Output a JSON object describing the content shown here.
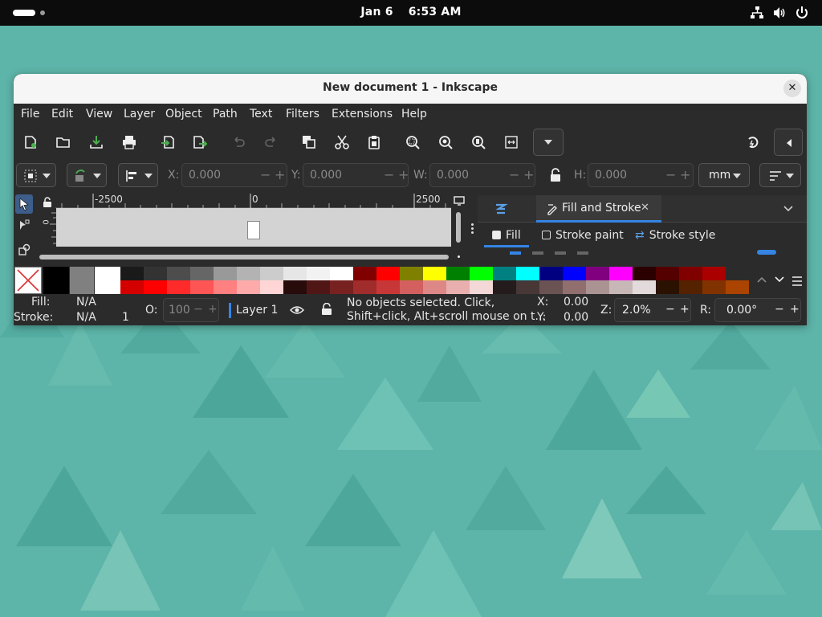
{
  "topbar": {
    "date": "Jan 6",
    "time": "6:53 AM",
    "tray_icons": [
      "network-icon",
      "volume-icon",
      "power-icon"
    ]
  },
  "window": {
    "title": "New document 1 - Inkscape",
    "close_label": "✕"
  },
  "menu": [
    "File",
    "Edit",
    "View",
    "Layer",
    "Object",
    "Path",
    "Text",
    "Filters",
    "Extensions",
    "Help"
  ],
  "toolbar": {
    "icons": [
      "new-document-icon",
      "open-icon",
      "save-icon",
      "print-icon",
      "import-icon",
      "export-icon",
      "undo-icon",
      "redo-icon",
      "duplicate-icon",
      "cut-icon",
      "paste-icon",
      "zoom-selection-icon",
      "zoom-drawing-icon",
      "zoom-page-icon",
      "zoom-width-icon",
      "more-dropdown-icon",
      "snap-icon",
      "collapse-icon"
    ]
  },
  "coords": {
    "x_label": "X:",
    "x_value": "0.000",
    "y_label": "Y:",
    "y_value": "0.000",
    "w_label": "W:",
    "w_value": "0.000",
    "h_label": "H:",
    "h_value": "0.000",
    "unit": "mm"
  },
  "ruler": {
    "h_ticks": [
      "-2500",
      "0",
      "2500"
    ],
    "v_tick": "0"
  },
  "dock": {
    "tab_label": "Fill and Stroke",
    "tab_close": "✕",
    "subtabs": [
      "Fill",
      "Stroke paint",
      "Stroke style"
    ]
  },
  "palette": {
    "row1": [
      "#000000",
      "#808080",
      "#ffffff",
      "#1a1a1a",
      "#333333",
      "#4d4d4d",
      "#666666",
      "#999999",
      "#b3b3b3",
      "#cccccc",
      "#e6e6e6",
      "#f2f2f2",
      "#ffffff",
      "#800000",
      "#ff0000",
      "#808000",
      "#ffff00",
      "#008000",
      "#00ff00",
      "#008080",
      "#00ffff",
      "#000080",
      "#0000ff",
      "#800080",
      "#ff00ff",
      "#2b0000",
      "#550000",
      "#800000",
      "#aa0000"
    ],
    "row2": [
      "#000000",
      "#808080",
      "#ffffff",
      "#d40000",
      "#ff0000",
      "#ff2a2a",
      "#ff5555",
      "#ff8080",
      "#ffaaaa",
      "#ffd5d5",
      "#280b0b",
      "#501616",
      "#782121",
      "#a02c2c",
      "#c83737",
      "#d35f5f",
      "#de8787",
      "#e9afaf",
      "#f4d7d7",
      "#241c1c",
      "#483737",
      "#6c5353",
      "#916f6f",
      "#ac9393",
      "#c8b7b7",
      "#e3dbdb",
      "#2b1100",
      "#552200",
      "#803300",
      "#aa4400",
      "#d45500"
    ]
  },
  "status": {
    "fill_label": "Fill:",
    "fill_value": "N/A",
    "stroke_label": "Stroke:",
    "stroke_value": "N/A",
    "stroke_width": "1",
    "opacity_label": "O:",
    "opacity_value": "100",
    "layer_name": "Layer 1",
    "message_line1": "No objects selected. Click,",
    "message_line2": "Shift+click, Alt+scroll mouse on t...",
    "x_label": "X:",
    "x_value": "0.00",
    "y_label": "Y:",
    "y_value": "0.00",
    "zoom_label": "Z:",
    "zoom_value": "2.0%",
    "rotation_label": "R:",
    "rotation_value": "0.00°"
  }
}
